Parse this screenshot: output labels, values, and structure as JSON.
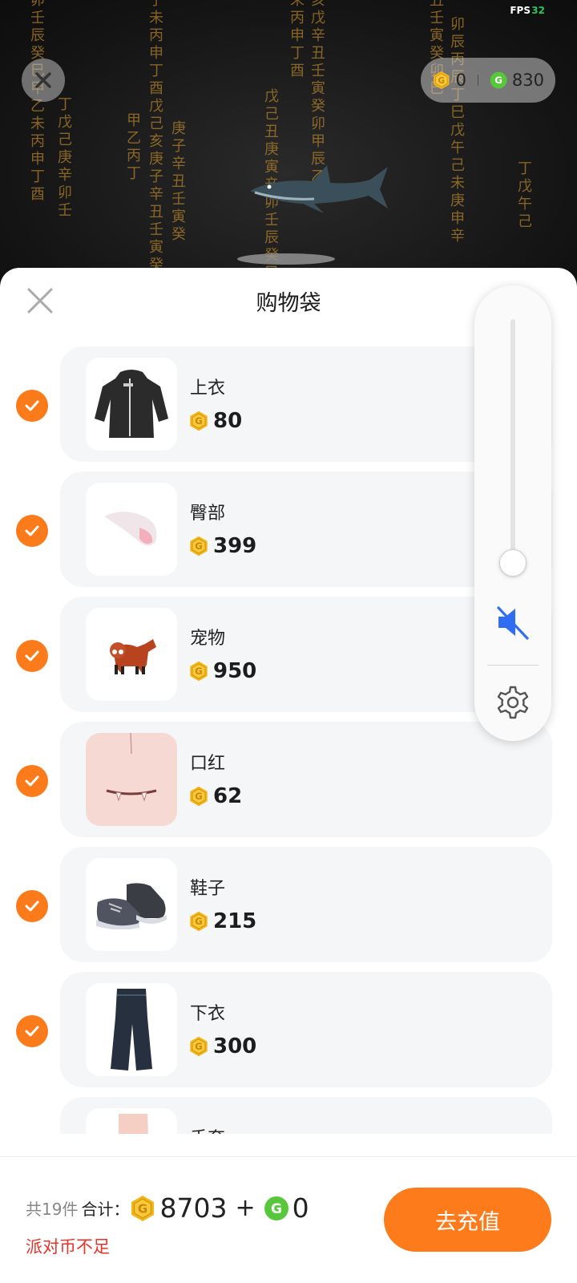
{
  "hud": {
    "fps_label": "FPS",
    "fps_value": "32"
  },
  "wallet": {
    "coin_a": "0",
    "coin_b": "830"
  },
  "sheet": {
    "title": "购物袋"
  },
  "items": [
    {
      "name": "上衣",
      "price": "80",
      "thumb_icon": "hoodie-icon"
    },
    {
      "name": "臀部",
      "price": "399",
      "thumb_icon": "tail-icon"
    },
    {
      "name": "宠物",
      "price": "950",
      "thumb_icon": "red-panda-icon"
    },
    {
      "name": "口红",
      "price": "62",
      "thumb_icon": "fang-lips-icon"
    },
    {
      "name": "鞋子",
      "price": "215",
      "thumb_icon": "sneakers-icon"
    },
    {
      "name": "下衣",
      "price": "300",
      "thumb_icon": "jeans-icon"
    },
    {
      "name": "手套",
      "price": "",
      "thumb_icon": "glove-icon"
    }
  ],
  "volume": {
    "level": 0.05,
    "muted": true
  },
  "footer": {
    "count_text": "共19件",
    "total_label": "合计：",
    "total_gold": "8703",
    "plus": "+",
    "total_green": "0",
    "warning": "派对币不足",
    "recharge_label": "去充值"
  },
  "colors": {
    "accent": "#fd7b1a",
    "warning": "#e8322a",
    "gold": "#f2b619",
    "green_coin": "#57c83c"
  }
}
